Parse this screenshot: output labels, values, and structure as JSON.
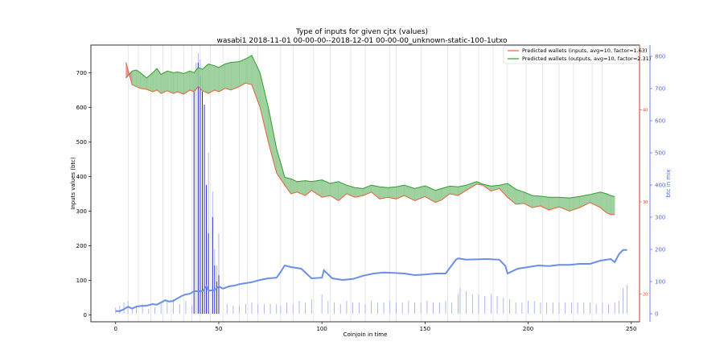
{
  "chart_data": {
    "type": "line",
    "title": "Type of inputs for given cjtx (values)",
    "subtitle": "wasabi1 2018-11-01 00-00-00--2018-12-01 00-00-00_unknown-static-100-1utxo",
    "xlabel": "Coinjoin in time",
    "ylabel": "Inputs values (btc)",
    "y2label": "btc in mix",
    "xlim": [
      -12,
      254
    ],
    "ylim": [
      -20,
      780
    ],
    "y2lim": [
      -25,
      835
    ],
    "y3lim": [
      17,
      47
    ],
    "xticks": [
      "0",
      "50",
      "100",
      "150",
      "200",
      "250"
    ],
    "yticks": [
      "0",
      "100",
      "200",
      "300",
      "400",
      "500",
      "600",
      "700"
    ],
    "y2ticks": [
      "0",
      "100",
      "200",
      "300",
      "400",
      "500",
      "600",
      "700",
      "800"
    ],
    "y3ticks": [
      "20",
      "30",
      "40"
    ],
    "legend_position": "top-right",
    "legend": [
      "Predicted wallets (inputs, avg=10, factor=1.63)",
      "Predicted wallets (outputs, avg=10, factor=2.31)"
    ],
    "colors": {
      "inputs": "#e8603c",
      "outputs": "#2ca02c",
      "fill_green": "#8fc98f",
      "fill_red": "#f08080",
      "btc_mix": "#6b8fe8",
      "bars_light": "#9aa8f0",
      "bars_dark": "#1a1ad0"
    },
    "series": [
      {
        "name": "Predicted wallets (inputs, avg=10, factor=1.63)",
        "x": [
          5,
          8,
          10,
          12,
          15,
          18,
          20,
          22,
          25,
          28,
          30,
          33,
          36,
          38,
          40,
          42,
          45,
          48,
          50,
          53,
          56,
          60,
          63,
          66,
          70,
          74,
          78,
          82,
          85,
          88,
          92,
          95,
          100,
          104,
          108,
          112,
          116,
          120,
          124,
          128,
          132,
          136,
          140,
          145,
          150,
          155,
          158,
          162,
          166,
          170,
          175,
          178,
          182,
          186,
          190,
          194,
          198,
          202,
          206,
          210,
          215,
          220,
          225,
          230,
          235,
          238,
          240,
          242
        ],
        "y": [
          730,
          665,
          660,
          655,
          652,
          645,
          650,
          640,
          648,
          640,
          645,
          638,
          650,
          645,
          660,
          648,
          640,
          650,
          645,
          655,
          650,
          660,
          670,
          665,
          600,
          500,
          410,
          375,
          350,
          355,
          345,
          360,
          340,
          345,
          330,
          350,
          340,
          345,
          355,
          335,
          340,
          335,
          345,
          330,
          342,
          325,
          332,
          350,
          345,
          360,
          378,
          375,
          358,
          365,
          340,
          320,
          322,
          310,
          315,
          303,
          312,
          300,
          310,
          325,
          310,
          295,
          290,
          290
        ]
      },
      {
        "name": "Predicted wallets (outputs, avg=10, factor=2.31)",
        "x": [
          5,
          8,
          10,
          12,
          15,
          18,
          20,
          22,
          25,
          28,
          30,
          33,
          36,
          38,
          40,
          42,
          45,
          48,
          50,
          53,
          56,
          60,
          63,
          66,
          70,
          74,
          78,
          82,
          85,
          88,
          92,
          95,
          100,
          104,
          108,
          112,
          116,
          120,
          124,
          128,
          132,
          136,
          140,
          145,
          150,
          155,
          158,
          162,
          166,
          170,
          175,
          178,
          182,
          186,
          190,
          194,
          198,
          202,
          206,
          210,
          215,
          220,
          225,
          230,
          235,
          238,
          240,
          242
        ],
        "y": [
          685,
          705,
          708,
          700,
          685,
          700,
          712,
          695,
          705,
          700,
          702,
          698,
          705,
          700,
          715,
          710,
          725,
          720,
          715,
          725,
          730,
          732,
          740,
          750,
          700,
          600,
          480,
          398,
          393,
          385,
          388,
          385,
          390,
          380,
          385,
          375,
          368,
          365,
          375,
          370,
          368,
          370,
          375,
          365,
          373,
          360,
          365,
          372,
          370,
          375,
          385,
          378,
          372,
          375,
          380,
          363,
          355,
          345,
          343,
          340,
          340,
          338,
          342,
          348,
          355,
          350,
          345,
          342
        ]
      },
      {
        "name": "",
        "axis": "right",
        "x": [
          0,
          2,
          4,
          6,
          8,
          10,
          12,
          15,
          18,
          20,
          22,
          24,
          26,
          28,
          30,
          32,
          34,
          36,
          38,
          40,
          42,
          44,
          45,
          48,
          50,
          52,
          55,
          58,
          60,
          63,
          66,
          70,
          74,
          78,
          80,
          82,
          85,
          90,
          95,
          100,
          101,
          105,
          110,
          115,
          120,
          125,
          130,
          135,
          140,
          145,
          150,
          155,
          160,
          165,
          166,
          170,
          180,
          186,
          189,
          190,
          195,
          200,
          205,
          210,
          215,
          220,
          225,
          230,
          235,
          240,
          242,
          244,
          246,
          248
        ],
        "y": [
          8,
          8,
          14,
          22,
          16,
          22,
          24,
          25,
          30,
          28,
          35,
          42,
          38,
          40,
          48,
          55,
          60,
          62,
          70,
          70,
          70,
          85,
          72,
          73,
          85,
          78,
          85,
          88,
          92,
          95,
          98,
          105,
          110,
          112,
          130,
          150,
          145,
          140,
          110,
          112,
          135,
          110,
          105,
          108,
          118,
          125,
          128,
          127,
          125,
          120,
          122,
          125,
          125,
          168,
          172,
          168,
          170,
          168,
          148,
          125,
          140,
          145,
          150,
          148,
          152,
          152,
          155,
          155,
          165,
          170,
          160,
          185,
          198,
          198
        ]
      }
    ],
    "bars": {
      "name": "",
      "axis": "right",
      "x": [
        0,
        2,
        4,
        6,
        8,
        10,
        13,
        16,
        19,
        22,
        25,
        28,
        31,
        34,
        37,
        38,
        39,
        40,
        41,
        42,
        43,
        44,
        45,
        47,
        48,
        49,
        50,
        54,
        57,
        60,
        63,
        66,
        69,
        72,
        75,
        78,
        80,
        83,
        86,
        89,
        92,
        95,
        100,
        103,
        106,
        109,
        112,
        115,
        118,
        121,
        124,
        127,
        130,
        133,
        136,
        139,
        142,
        145,
        148,
        151,
        154,
        157,
        160,
        163,
        166,
        167,
        170,
        173,
        176,
        179,
        182,
        185,
        188,
        191,
        194,
        197,
        200,
        203,
        206,
        209,
        212,
        215,
        218,
        221,
        224,
        227,
        230,
        233,
        236,
        239,
        242,
        244,
        246,
        248
      ],
      "y": [
        20,
        25,
        35,
        40,
        20,
        25,
        30,
        15,
        20,
        35,
        40,
        45,
        30,
        40,
        25,
        700,
        780,
        810,
        790,
        700,
        650,
        260,
        500,
        380,
        200,
        150,
        250,
        30,
        25,
        25,
        30,
        35,
        30,
        30,
        30,
        30,
        25,
        35,
        30,
        40,
        35,
        45,
        60,
        40,
        35,
        30,
        40,
        35,
        35,
        30,
        40,
        35,
        35,
        40,
        35,
        35,
        40,
        35,
        35,
        40,
        35,
        35,
        40,
        35,
        60,
        80,
        70,
        60,
        60,
        55,
        60,
        55,
        50,
        45,
        35,
        35,
        40,
        40,
        35,
        35,
        35,
        35,
        35,
        35,
        35,
        35,
        35,
        30,
        35,
        30,
        35,
        40,
        80,
        90
      ]
    },
    "dark_bars": {
      "name": "",
      "axis": "right",
      "x": [
        38,
        40,
        41,
        42,
        43,
        44,
        45,
        47,
        48,
        49,
        50
      ],
      "y": [
        700,
        780,
        740,
        690,
        650,
        400,
        250,
        300,
        150,
        100,
        120
      ]
    },
    "vlines": [
      6,
      11,
      17,
      23,
      27,
      33,
      37,
      41,
      46,
      52,
      60,
      64,
      69,
      80,
      86,
      96,
      104,
      114,
      121,
      133,
      136,
      148,
      161,
      167,
      176,
      183,
      190,
      199,
      207,
      215,
      222,
      231,
      236
    ]
  }
}
